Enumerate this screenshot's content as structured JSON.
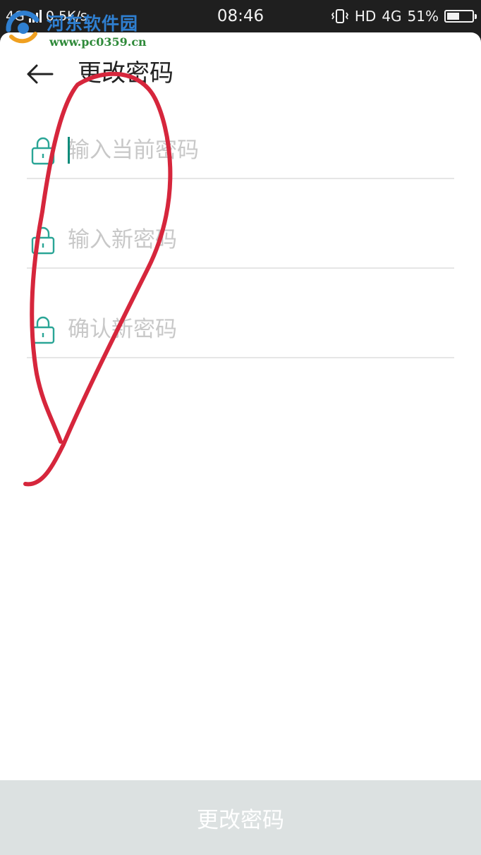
{
  "status_bar": {
    "network_left": "4G",
    "speed": "0.5K/s",
    "time": "08:46",
    "hd": "HD",
    "network_right": "4G",
    "battery": "51%",
    "battery_level": 0.51
  },
  "watermark": {
    "name": "河东软件园",
    "url": "www.pc0359.cn"
  },
  "header": {
    "title": "更改密码"
  },
  "form": {
    "current_password_placeholder": "输入当前密码",
    "new_password_placeholder": "输入新密码",
    "confirm_password_placeholder": "确认新密码"
  },
  "submit": {
    "label": "更改密码"
  },
  "colors": {
    "accent": "#0b8b7a",
    "annotation": "#d6263c",
    "button_bg": "#dce1e1"
  },
  "icons": {
    "back": "arrow-left-icon",
    "lock": "lock-icon",
    "vibrate": "vibrate-icon",
    "battery": "battery-icon"
  }
}
